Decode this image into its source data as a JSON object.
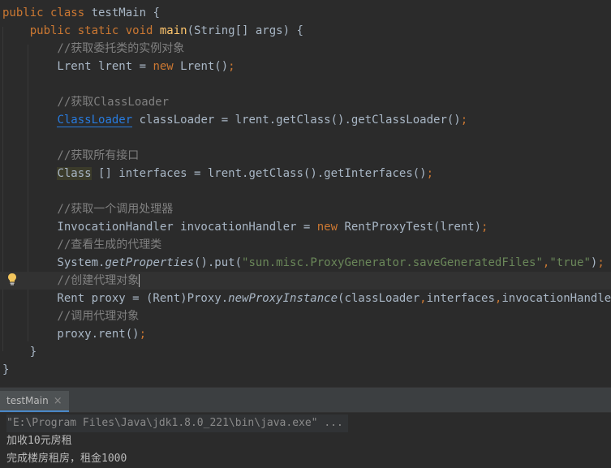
{
  "editor": {
    "lines": [
      {
        "segments": [
          {
            "t": "public class ",
            "c": "kw"
          },
          {
            "t": "testMain",
            "c": ""
          },
          {
            "t": " {",
            "c": ""
          }
        ]
      },
      {
        "segments": [
          {
            "t": "    public static void ",
            "c": "kw"
          },
          {
            "t": "main",
            "c": "fn"
          },
          {
            "t": "(String[] args) {",
            "c": ""
          }
        ]
      },
      {
        "segments": [
          {
            "t": "        //获取委托类的实例对象",
            "c": "cm"
          }
        ]
      },
      {
        "segments": [
          {
            "t": "        Lrent lrent = ",
            "c": ""
          },
          {
            "t": "new ",
            "c": "kw"
          },
          {
            "t": "Lrent()",
            "c": ""
          },
          {
            "t": ";",
            "c": "kw"
          }
        ]
      },
      {
        "segments": []
      },
      {
        "segments": [
          {
            "t": "        //获取ClassLoader",
            "c": "cm"
          }
        ]
      },
      {
        "segments": [
          {
            "t": "        ",
            "c": ""
          },
          {
            "t": "ClassLoader",
            "c": "err-cls"
          },
          {
            "t": " classLoader = lrent.getClass().getClassLoader()",
            "c": ""
          },
          {
            "t": ";",
            "c": "kw"
          }
        ]
      },
      {
        "segments": []
      },
      {
        "segments": [
          {
            "t": "        //获取所有接口",
            "c": "cm"
          }
        ]
      },
      {
        "segments": [
          {
            "t": "        ",
            "c": ""
          },
          {
            "t": "Class",
            "c": "cls-bg"
          },
          {
            "t": " [] interfaces = lrent.getClass().getInterfaces()",
            "c": ""
          },
          {
            "t": ";",
            "c": "kw"
          }
        ]
      },
      {
        "segments": []
      },
      {
        "segments": [
          {
            "t": "        //获取一个调用处理器",
            "c": "cm"
          }
        ]
      },
      {
        "segments": [
          {
            "t": "        InvocationHandler invocationHandler = ",
            "c": ""
          },
          {
            "t": "new ",
            "c": "kw"
          },
          {
            "t": "RentProxyTest(lrent)",
            "c": ""
          },
          {
            "t": ";",
            "c": "kw"
          }
        ]
      },
      {
        "segments": [
          {
            "t": "        //查看生成的代理类",
            "c": "cm"
          }
        ]
      },
      {
        "segments": [
          {
            "t": "        System.",
            "c": ""
          },
          {
            "t": "getProperties",
            "c": "it"
          },
          {
            "t": "().put(",
            "c": ""
          },
          {
            "t": "\"sun.misc.ProxyGenerator.saveGeneratedFiles\"",
            "c": "str"
          },
          {
            "t": ",",
            "c": "kw"
          },
          {
            "t": "\"true\"",
            "c": "str"
          },
          {
            "t": ")",
            "c": ""
          },
          {
            "t": ";",
            "c": "kw"
          }
        ]
      },
      {
        "segments": [
          {
            "t": "        //创建代理对象",
            "c": "cm"
          }
        ]
      },
      {
        "segments": [
          {
            "t": "        Rent proxy = (Rent)Proxy.",
            "c": ""
          },
          {
            "t": "newProxyInstance",
            "c": "it"
          },
          {
            "t": "(classLoader",
            "c": ""
          },
          {
            "t": ",",
            "c": "kw"
          },
          {
            "t": "interfaces",
            "c": ""
          },
          {
            "t": ",",
            "c": "kw"
          },
          {
            "t": "invocationHandler)",
            "c": ""
          },
          {
            "t": ";",
            "c": "kw"
          }
        ]
      },
      {
        "segments": [
          {
            "t": "        //调用代理对象",
            "c": "cm"
          }
        ]
      },
      {
        "segments": [
          {
            "t": "        proxy.rent()",
            "c": ""
          },
          {
            "t": ";",
            "c": "kw"
          }
        ]
      },
      {
        "segments": [
          {
            "t": "    }",
            "c": ""
          }
        ]
      },
      {
        "segments": [
          {
            "t": "}",
            "c": ""
          }
        ]
      }
    ],
    "current_line": 15
  },
  "run": {
    "tab_label": "testMain",
    "tab_close": "×",
    "command": "\"E:\\Program Files\\Java\\jdk1.8.0_221\\bin\\java.exe\" ...",
    "output": [
      "加收10元房租",
      "完成楼房租房，租金1000"
    ]
  },
  "icons": {
    "bulb": "lightbulb-icon",
    "close": "close-icon",
    "run-config": "run-config-icon"
  },
  "colors": {
    "background": "#2b2b2b",
    "keyword": "#cc7832",
    "function": "#ffc66d",
    "comment": "#808080",
    "string": "#6a8759"
  }
}
